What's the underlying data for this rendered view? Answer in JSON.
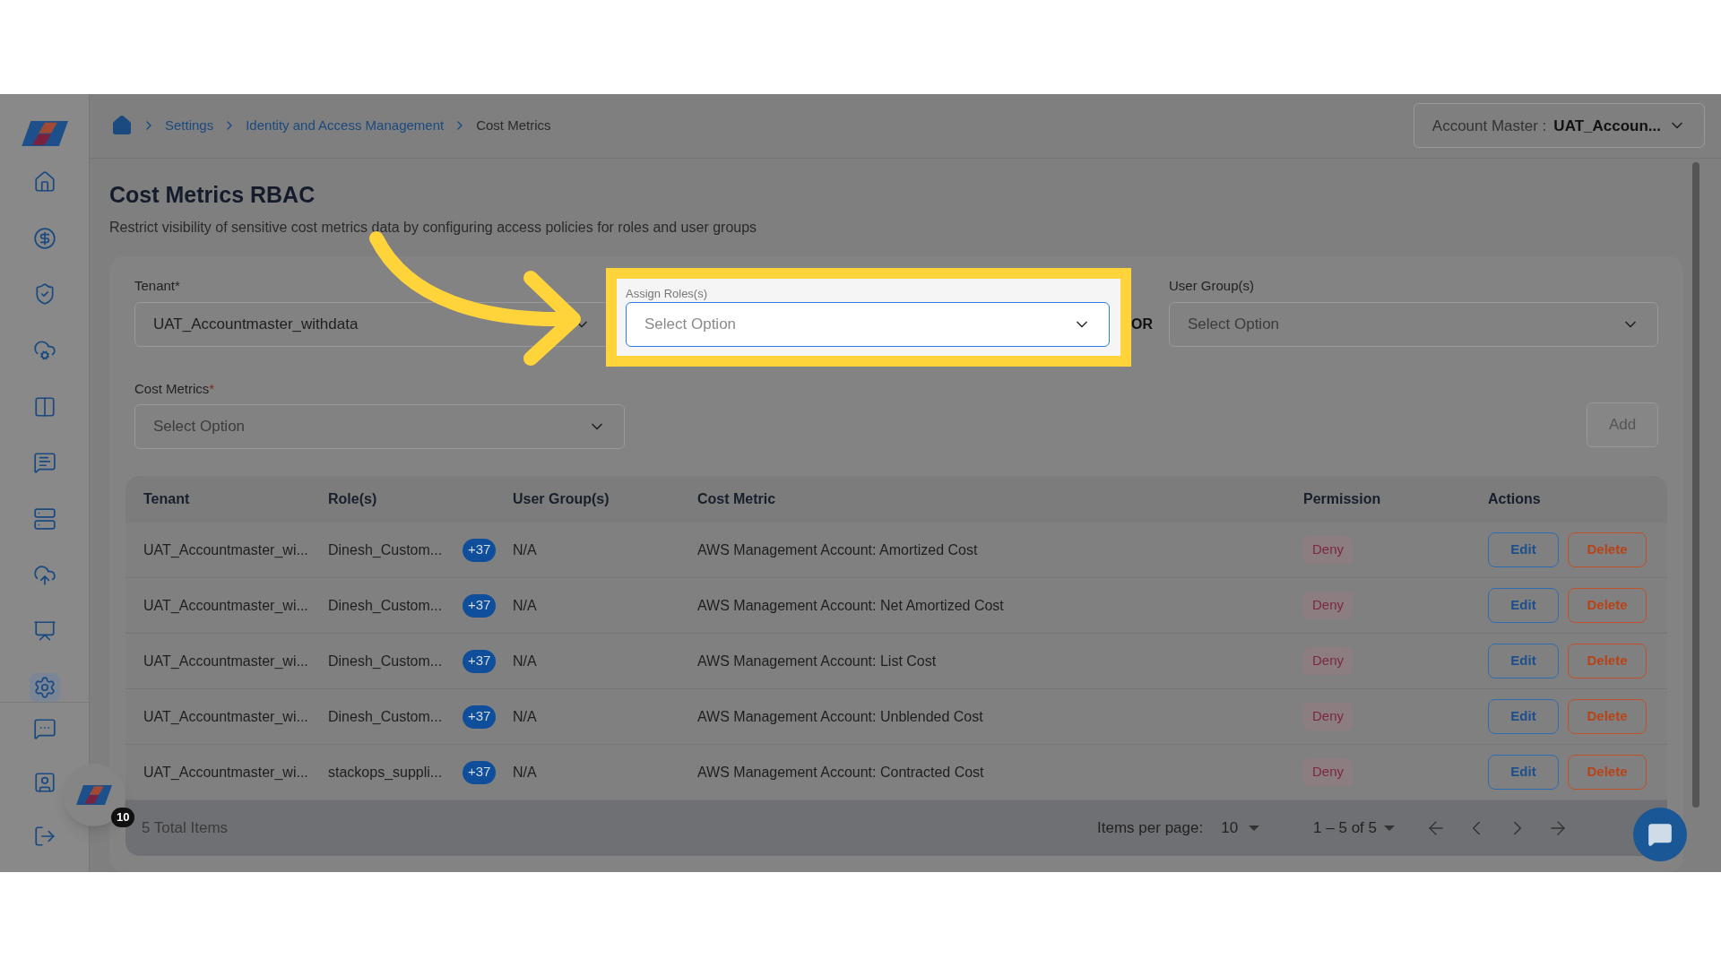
{
  "sidebar": {
    "items": [
      {
        "kind": "home",
        "selected": false
      },
      {
        "kind": "dollar",
        "selected": false
      },
      {
        "kind": "shield",
        "selected": false
      },
      {
        "kind": "cloud-network",
        "selected": false
      },
      {
        "kind": "split",
        "selected": false
      },
      {
        "kind": "ai-chat",
        "selected": false
      },
      {
        "kind": "server",
        "selected": false
      },
      {
        "kind": "cloud-user",
        "selected": false
      },
      {
        "kind": "presentation",
        "selected": false
      },
      {
        "kind": "settings",
        "selected": true
      }
    ],
    "bottom_items": [
      {
        "kind": "chat"
      },
      {
        "kind": "user"
      },
      {
        "kind": "logout"
      }
    ]
  },
  "breadcrumbs": [
    {
      "label": "Settings",
      "current": false
    },
    {
      "label": "Identity and Access Management",
      "current": false
    },
    {
      "label": "Cost Metrics",
      "current": true
    }
  ],
  "account_selector": {
    "label": "Account Master :",
    "value": "UAT_Accoun..."
  },
  "page": {
    "title": "Cost Metrics RBAC",
    "subtitle": "Restrict visibility of sensitive cost metrics data by configuring access policies for roles and user groups"
  },
  "form": {
    "tenant": {
      "label": "Tenant*",
      "value": "UAT_Accountmaster_withdata"
    },
    "roles": {
      "label": "Assign Roles(s)",
      "placeholder": "Select Option",
      "highlighted": true
    },
    "separator": "OR",
    "user_groups": {
      "label": "User Group(s)",
      "placeholder": "Select Option"
    },
    "cost_metrics": {
      "label": "Cost Metrics",
      "required_mark": "*",
      "placeholder": "Select Option"
    },
    "add_button": {
      "label": "Add",
      "disabled": true
    }
  },
  "table": {
    "columns": [
      "Tenant",
      "Role(s)",
      "User Group(s)",
      "Cost Metric",
      "Permission",
      "Actions"
    ],
    "rows": [
      {
        "tenant": "UAT_Accountmaster_wi...",
        "role": "Dinesh_Custom...",
        "role_more": "+37",
        "user_group": "N/A",
        "cost_metric": "AWS Management Account: Amortized Cost",
        "permission": "Deny",
        "actions": [
          "Edit",
          "Delete"
        ]
      },
      {
        "tenant": "UAT_Accountmaster_wi...",
        "role": "Dinesh_Custom...",
        "role_more": "+37",
        "user_group": "N/A",
        "cost_metric": "AWS Management Account: Net Amortized Cost",
        "permission": "Deny",
        "actions": [
          "Edit",
          "Delete"
        ]
      },
      {
        "tenant": "UAT_Accountmaster_wi...",
        "role": "Dinesh_Custom...",
        "role_more": "+37",
        "user_group": "N/A",
        "cost_metric": "AWS Management Account: List Cost",
        "permission": "Deny",
        "actions": [
          "Edit",
          "Delete"
        ]
      },
      {
        "tenant": "UAT_Accountmaster_wi...",
        "role": "Dinesh_Custom...",
        "role_more": "+37",
        "user_group": "N/A",
        "cost_metric": "AWS Management Account: Unblended Cost",
        "permission": "Deny",
        "actions": [
          "Edit",
          "Delete"
        ]
      },
      {
        "tenant": "UAT_Accountmaster_wi...",
        "role": "stackops_suppli...",
        "role_more": "+37",
        "user_group": "N/A",
        "cost_metric": "AWS Management Account: Contracted Cost",
        "permission": "Deny",
        "actions": [
          "Edit",
          "Delete"
        ]
      }
    ],
    "footer": {
      "total": "5 Total Items",
      "items_per_page_label": "Items per page:",
      "items_per_page": "10",
      "range": "1 – 5 of 5"
    }
  },
  "assistant_badge": "10"
}
